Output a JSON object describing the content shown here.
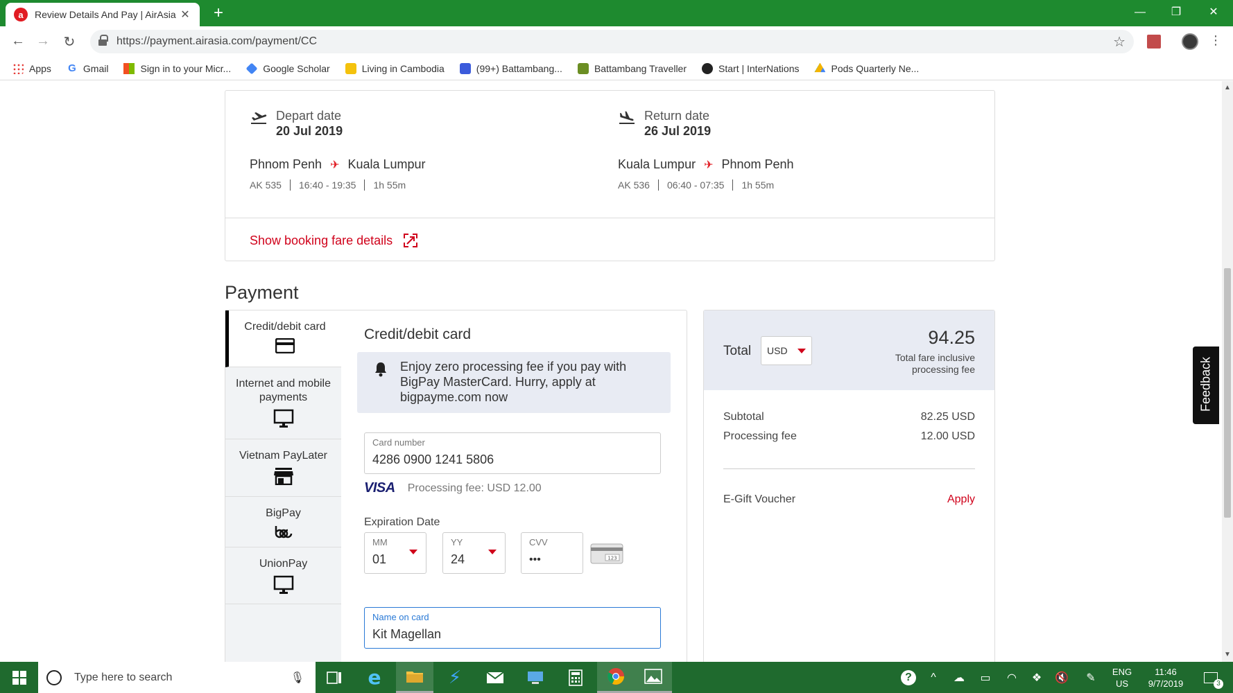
{
  "browser": {
    "tab_title": "Review Details And Pay | AirAsia",
    "tab_favicon_letter": "a",
    "url": "https://payment.airasia.com/payment/CC",
    "bookmarks": [
      {
        "label": "Apps",
        "icon": "apps-grid-icon"
      },
      {
        "label": "Gmail",
        "icon": "google-icon"
      },
      {
        "label": "Sign in to your Micr...",
        "icon": "microsoft-icon"
      },
      {
        "label": "Google Scholar",
        "icon": "scholar-icon"
      },
      {
        "label": "Living in Cambodia",
        "icon": "folder-icon"
      },
      {
        "label": "(99+) Battambang...",
        "icon": "chat-icon"
      },
      {
        "label": "Battambang Traveller",
        "icon": "image-icon"
      },
      {
        "label": "Start | InterNations",
        "icon": "globe-icon"
      },
      {
        "label": "Pods Quarterly Ne...",
        "icon": "drive-icon"
      }
    ]
  },
  "flights": {
    "depart": {
      "label": "Depart date",
      "date": "20 Jul 2019",
      "from": "Phnom Penh",
      "to": "Kuala Lumpur",
      "flight_no": "AK 535",
      "time": "16:40 - 19:35",
      "duration": "1h 55m"
    },
    "return": {
      "label": "Return date",
      "date": "26 Jul 2019",
      "from": "Kuala Lumpur",
      "to": "Phnom Penh",
      "flight_no": "AK 536",
      "time": "06:40 - 07:35",
      "duration": "1h 55m"
    },
    "fare_link": "Show booking fare details"
  },
  "payment": {
    "title": "Payment",
    "methods": [
      {
        "label": "Credit/debit card",
        "icon": "credit-card-icon",
        "active": true
      },
      {
        "label": "Internet and mobile payments",
        "icon": "monitor-icon",
        "active": false
      },
      {
        "label": "Vietnam PayLater",
        "icon": "store-icon",
        "active": false
      },
      {
        "label": "BigPay",
        "icon": "bigpay-icon",
        "active": false
      },
      {
        "label": "UnionPay",
        "icon": "monitor-icon",
        "active": false
      }
    ],
    "form": {
      "heading": "Credit/debit card",
      "promo": "Enjoy zero processing fee if you pay with BigPay MasterCard. Hurry, apply at bigpayme.com now",
      "card_number_label": "Card number",
      "card_number": "4286 0900 1241 5806",
      "card_brand": "VISA",
      "processing_fee_note": "Processing fee: USD 12.00",
      "expiration_label": "Expiration Date",
      "mm_label": "MM",
      "mm_value": "01",
      "yy_label": "YY",
      "yy_value": "24",
      "cvv_label": "CVV",
      "cvv_value": "•••",
      "cvv_hint": "123",
      "name_label": "Name on card",
      "name_value": "Kit Magellan"
    }
  },
  "summary": {
    "total_label": "Total",
    "currency": "USD",
    "total_amount": "94.25",
    "total_note": "Total fare inclusive processing fee",
    "subtotal_label": "Subtotal",
    "subtotal_value": "82.25 USD",
    "fee_label": "Processing fee",
    "fee_value": "12.00 USD",
    "voucher_label": "E-Gift Voucher",
    "voucher_action": "Apply"
  },
  "feedback_label": "Feedback",
  "taskbar": {
    "search_placeholder": "Type here to search",
    "language_line1": "ENG",
    "language_line2": "US",
    "time": "11:46",
    "date": "9/7/2019",
    "notification_count": "3"
  },
  "colors": {
    "brand_red": "#d0021b",
    "chrome_green": "#1e8a2f",
    "focus_blue": "#2979d6",
    "panel_bg": "#e8ebf3"
  }
}
